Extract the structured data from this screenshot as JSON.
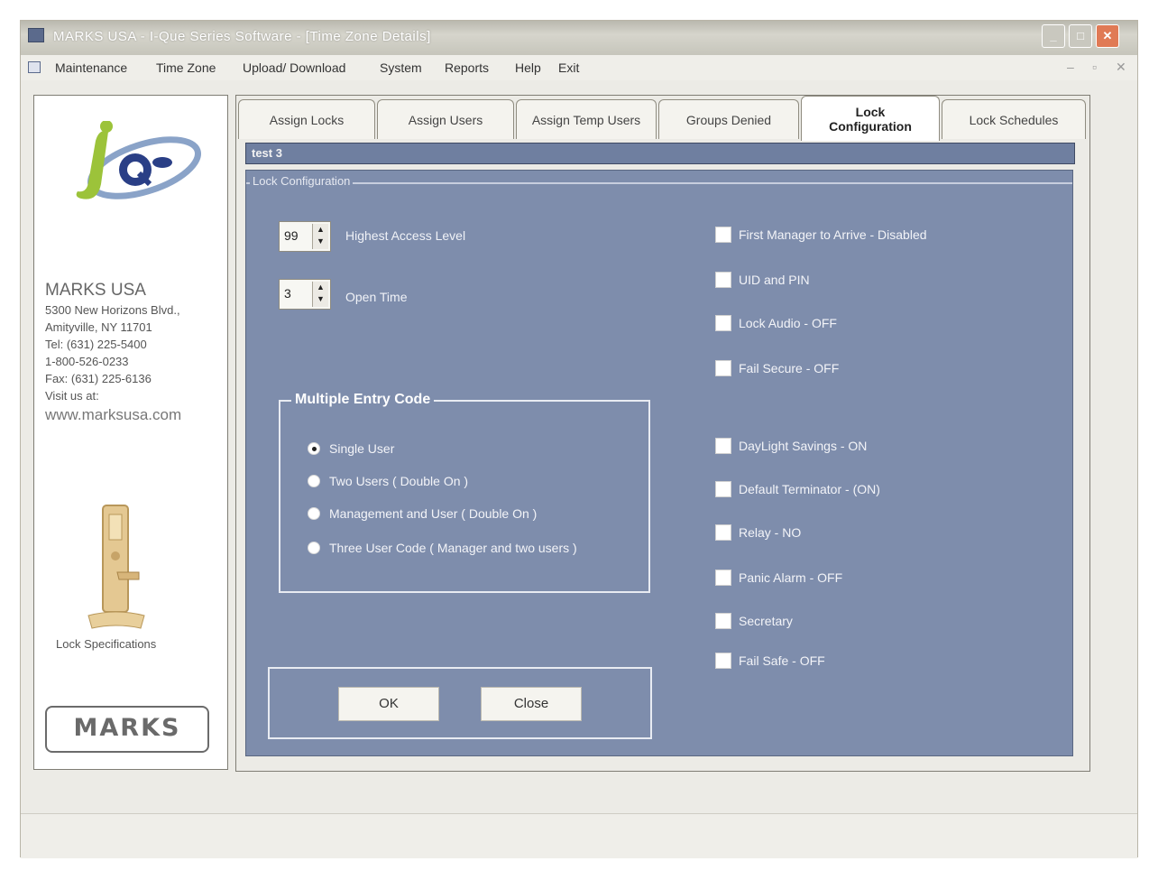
{
  "window": {
    "title": "MARKS USA - I-Que Series Software - [Time Zone Details]"
  },
  "menu": {
    "items": [
      "Maintenance",
      "Time Zone",
      "Upload/ Download",
      "System",
      "Reports",
      "Help",
      "Exit"
    ]
  },
  "left_panel": {
    "company": "MARKS USA",
    "address_lines": [
      "5300 New Horizons Blvd.,",
      "Amityville, NY 11701",
      "Tel: (631) 225-5400",
      "1-800-526-0233",
      "Fax: (631) 225-6136",
      "Visit us at:"
    ],
    "website": "www.marksusa.com",
    "lock_spec_label": "Lock Specifications",
    "marks_logo_text": "MARKS"
  },
  "tabs": [
    {
      "label": "Assign Locks"
    },
    {
      "label": "Assign Users"
    },
    {
      "label": "Assign Temp Users"
    },
    {
      "label": "Groups Denied"
    },
    {
      "label": "Lock Configuration"
    },
    {
      "label": "Lock Schedules"
    }
  ],
  "active_tab": "Lock Configuration",
  "lock_name": "test 3",
  "lock_config": {
    "legend": "Lock Configuration",
    "access_level": {
      "value": "99",
      "label": "Highest Access Level"
    },
    "open_time": {
      "value": "3",
      "label": "Open Time"
    },
    "multiple_entry": {
      "title": "Multiple Entry Code",
      "options": [
        "Single User",
        "Two Users ( Double On )",
        "Management and User ( Double On )",
        "Three User Code ( Manager and two users )"
      ],
      "selected": "Single User"
    },
    "checkboxes": [
      "First Manager to Arrive - Disabled",
      "UID and PIN",
      "Lock Audio - OFF",
      "Fail Secure - OFF",
      "DayLight Savings - ON",
      "Default Terminator - (ON)",
      "Relay - NO",
      "Panic Alarm - OFF",
      "Secretary",
      "Fail Safe - OFF"
    ]
  },
  "buttons": {
    "ok": "OK",
    "close": "Close"
  },
  "colors": {
    "config_bg": "#7e8dac",
    "name_bar": "#6f7fa0",
    "window_bg": "#ecebe6"
  }
}
